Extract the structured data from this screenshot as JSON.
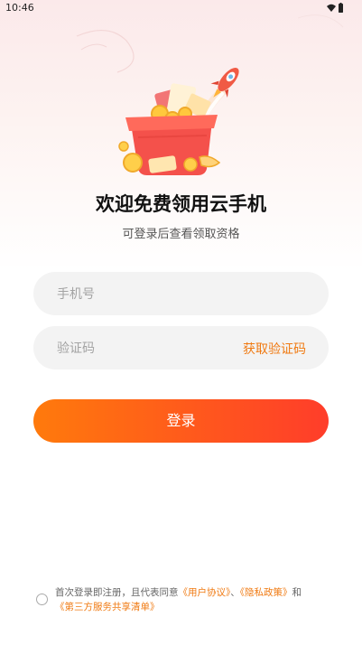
{
  "status_bar": {
    "time": "10:46",
    "icons": [
      "wifi-icon",
      "battery-icon"
    ]
  },
  "header": {
    "title": "欢迎免费领用云手机",
    "subtitle": "可登录后查看领取资格"
  },
  "form": {
    "phone_placeholder": "手机号",
    "code_placeholder": "验证码",
    "get_code_label": "获取验证码",
    "login_label": "登录"
  },
  "agreement": {
    "prefix": "首次登录即注册，且代表同意",
    "user_agreement": "《用户协议》",
    "sep1": "、",
    "privacy_policy": "《隐私政策》",
    "sep2": "和",
    "third_party": "《第三方服务共享清单》"
  },
  "colors": {
    "accent": "#f07a12",
    "button_start": "#ff7a0c",
    "button_end": "#ff3d2a"
  }
}
